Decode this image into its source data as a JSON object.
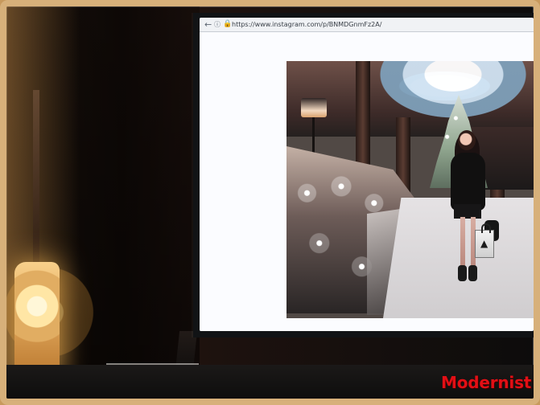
{
  "browser": {
    "url": "https://www.instagram.com/p/BNMDGnmFz2A/",
    "back_icon": "←",
    "info_icon": "ⓘ",
    "lock_icon": "🔒"
  },
  "watermark": {
    "text": "Modernist"
  },
  "colors": {
    "frame": "#d7b07a",
    "screen": "#f5f7fb",
    "watermark": "#e20f15"
  }
}
